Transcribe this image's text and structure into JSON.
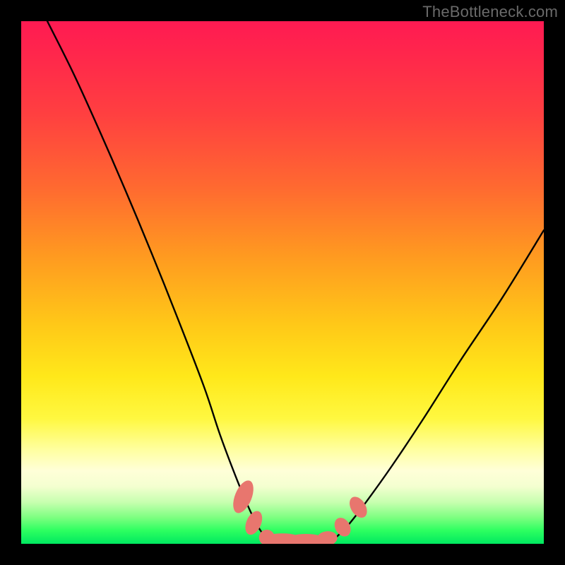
{
  "watermark": "TheBottleneck.com",
  "chart_data": {
    "type": "line",
    "title": "",
    "xlabel": "",
    "ylabel": "",
    "xlim": [
      0,
      100
    ],
    "ylim": [
      0,
      100
    ],
    "grid": false,
    "legend": false,
    "series": [
      {
        "name": "left-curve",
        "x": [
          5,
          10,
          15,
          20,
          25,
          30,
          35,
          38,
          41,
          43.5,
          45.5,
          47
        ],
        "y": [
          100,
          90,
          79,
          67.5,
          55.5,
          43,
          30,
          21,
          13,
          7,
          3,
          1
        ]
      },
      {
        "name": "right-curve",
        "x": [
          60,
          62.5,
          66,
          71,
          77,
          84,
          92,
          100
        ],
        "y": [
          1,
          3.5,
          8,
          15,
          24,
          35,
          47,
          60
        ]
      },
      {
        "name": "bottom-flat",
        "x": [
          47,
          49,
          51,
          53,
          55,
          57,
          59,
          60
        ],
        "y": [
          1,
          0.6,
          0.4,
          0.3,
          0.3,
          0.4,
          0.6,
          1
        ]
      }
    ],
    "markers": {
      "name": "salmon-dots",
      "color": "#e8766e",
      "points": [
        {
          "x": 42.5,
          "y": 9.0,
          "rx": 1.6,
          "ry": 3.3,
          "rot": 22
        },
        {
          "x": 44.5,
          "y": 4.0,
          "rx": 1.4,
          "ry": 2.4,
          "rot": 24
        },
        {
          "x": 47.0,
          "y": 1.2,
          "rx": 1.5,
          "ry": 1.5,
          "rot": 0
        },
        {
          "x": 50.0,
          "y": 0.7,
          "rx": 3.8,
          "ry": 1.3,
          "rot": 0
        },
        {
          "x": 54.5,
          "y": 0.6,
          "rx": 3.8,
          "ry": 1.3,
          "rot": 0
        },
        {
          "x": 58.5,
          "y": 1.0,
          "rx": 2.0,
          "ry": 1.4,
          "rot": -8
        },
        {
          "x": 61.5,
          "y": 3.2,
          "rx": 1.4,
          "ry": 1.9,
          "rot": -30
        },
        {
          "x": 64.5,
          "y": 7.0,
          "rx": 1.4,
          "ry": 2.2,
          "rot": -32
        }
      ]
    }
  }
}
